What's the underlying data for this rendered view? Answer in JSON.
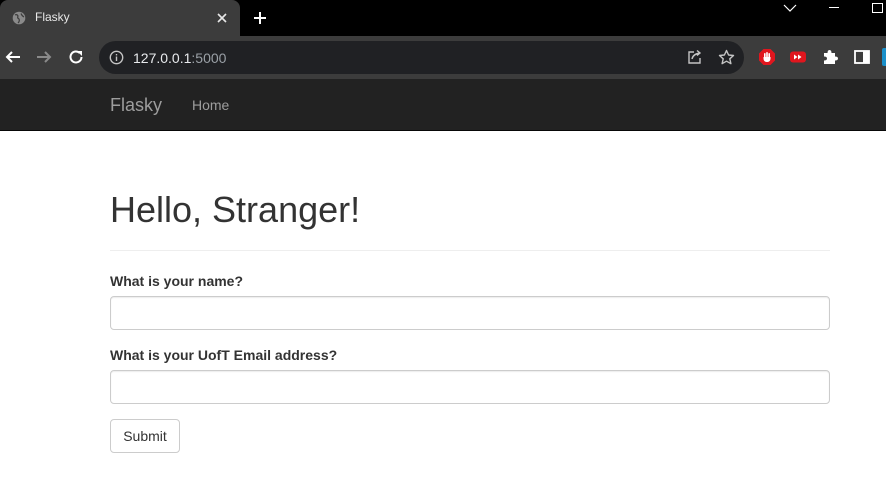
{
  "browser": {
    "tab": {
      "title": "Flasky",
      "favicon": "globe-icon",
      "close": "close-icon"
    },
    "new_tab": "plus-icon",
    "window_controls": [
      "chevron-down-icon",
      "minimize-icon",
      "maximize-icon"
    ],
    "toolbar": {
      "back": "back-arrow-icon",
      "forward": "forward-arrow-icon",
      "reload": "reload-icon"
    },
    "omnibox": {
      "info_icon": "info-icon",
      "url_host": "127.0.0.1",
      "url_port": ":5000",
      "share_icon": "share-icon",
      "bookmark_icon": "star-icon"
    },
    "extensions": [
      "stop-hand-icon",
      "youtube-icon",
      "puzzle-icon",
      "side-panel-icon"
    ]
  },
  "navbar": {
    "brand": "Flasky",
    "links": [
      {
        "label": "Home"
      }
    ]
  },
  "main": {
    "heading": "Hello, Stranger!",
    "form": {
      "name_label": "What is your name?",
      "name_value": "",
      "email_label": "What is your UofT Email address?",
      "email_value": "",
      "submit_label": "Submit"
    }
  },
  "colors": {
    "tabstrip": "#000000",
    "toolbar": "#3c3c3c",
    "navbar": "#222222",
    "navbar_text": "#9d9d9d",
    "heading_text": "#333333"
  }
}
